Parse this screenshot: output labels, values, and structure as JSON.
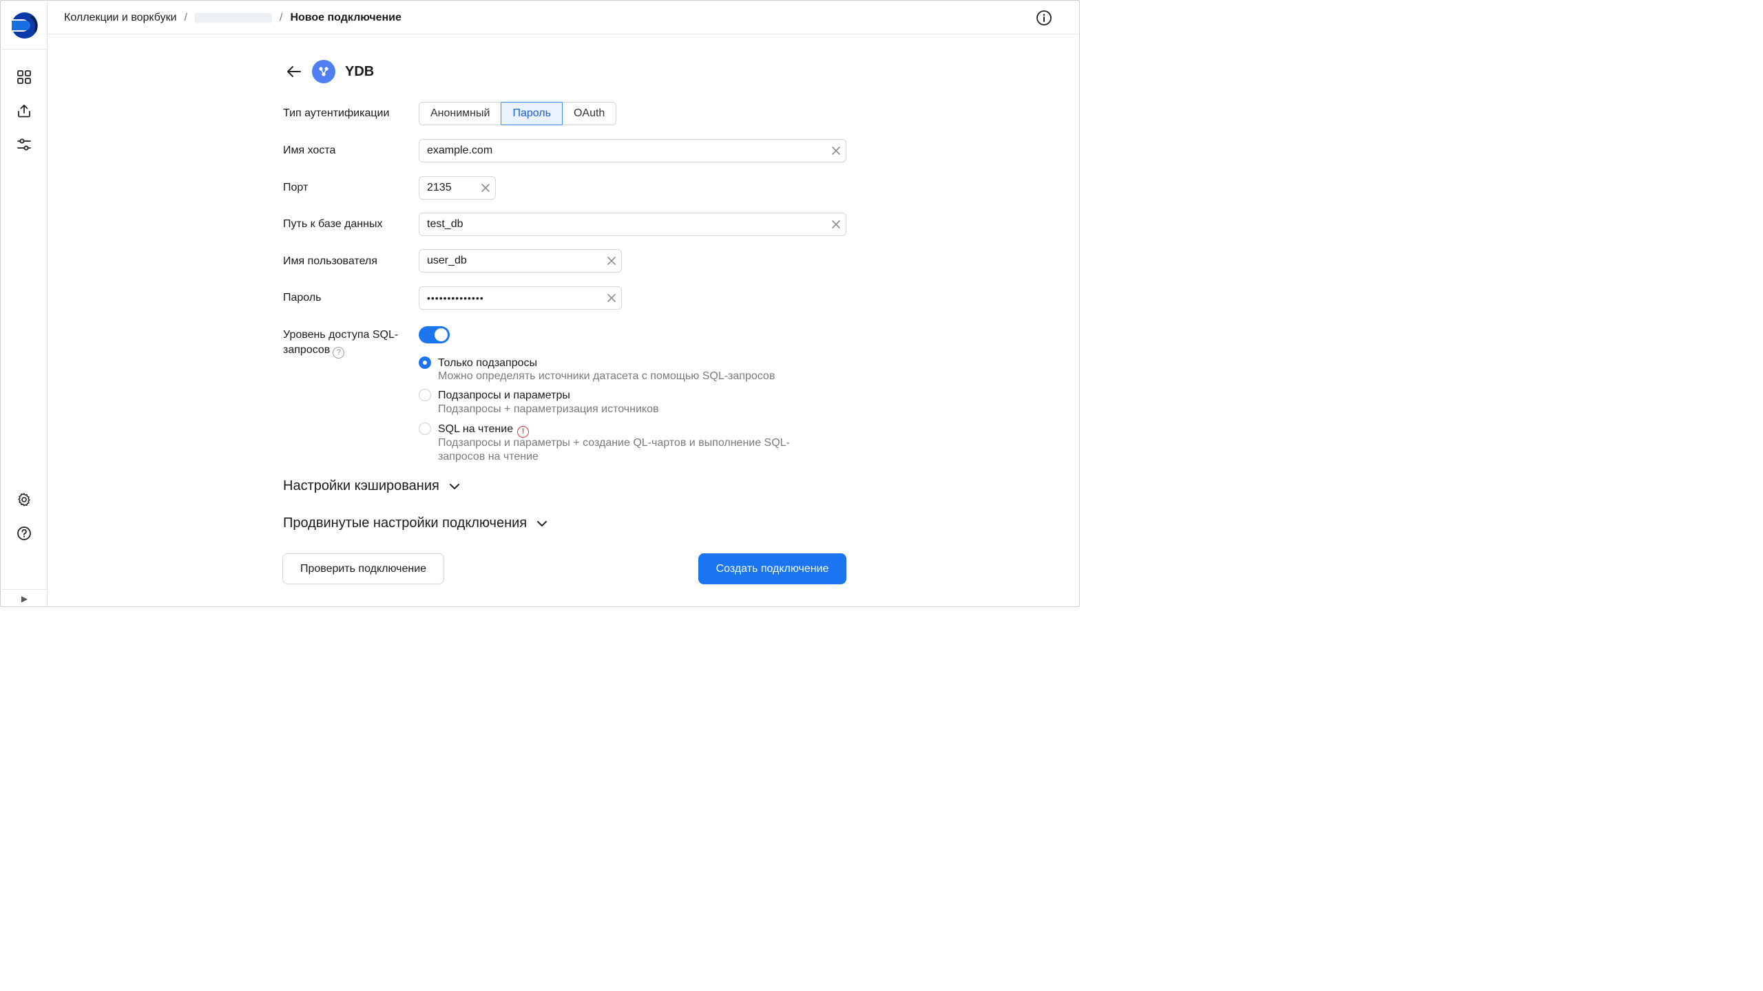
{
  "breadcrumb": {
    "root": "Коллекции и воркбуки",
    "separator": "/",
    "current": "Новое подключение"
  },
  "connection": {
    "title": "YDB"
  },
  "form": {
    "auth_type": {
      "label": "Тип аутентификации",
      "options": [
        "Анонимный",
        "Пароль",
        "OAuth"
      ],
      "selected": "Пароль"
    },
    "host": {
      "label": "Имя хоста",
      "value": "example.com"
    },
    "port": {
      "label": "Порт",
      "value": "2135"
    },
    "db_path": {
      "label": "Путь к базе данных",
      "value": "test_db"
    },
    "username": {
      "label": "Имя пользователя",
      "value": "user_db"
    },
    "password": {
      "label": "Пароль",
      "value": "••••••••••••••"
    },
    "sql_access": {
      "label": "Уровень доступа SQL-запросов",
      "label_line1": "Уровень доступа SQL-",
      "label_line2": "запросов",
      "enabled": true,
      "help_glyph": "?",
      "options": [
        {
          "title": "Только подзапросы",
          "description": "Можно определять источники датасета с помощью SQL-запросов",
          "checked": true
        },
        {
          "title": "Подзапросы и параметры",
          "description": "Подзапросы + параметризация источников",
          "checked": false
        },
        {
          "title": "SQL на чтение",
          "description_line1": "Подзапросы и параметры + создание QL-чартов и выполнение SQL-",
          "description_line2": "запросов на чтение",
          "warning_glyph": "!",
          "checked": false
        }
      ]
    }
  },
  "sections": {
    "caching": "Настройки кэширования",
    "advanced": "Продвинутые настройки подключения"
  },
  "actions": {
    "check": "Проверить подключение",
    "create": "Создать подключение"
  },
  "sidebar": {
    "items": [
      "grid-icon",
      "upload-icon",
      "sliders-icon"
    ],
    "bottom_items": [
      "settings-icon",
      "help-icon"
    ],
    "collapse_glyph": "▶"
  },
  "colors": {
    "accent": "#1c75f0",
    "accent_light": "#e9f2fe",
    "warning": "#d13a3a",
    "muted_text": "#7a7a7a",
    "border": "#d6d6d6"
  }
}
